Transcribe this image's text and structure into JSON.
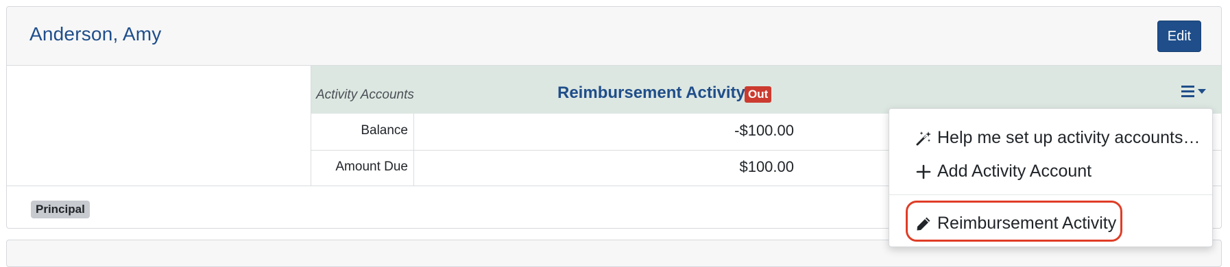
{
  "person": {
    "name": "Anderson, Amy"
  },
  "header": {
    "edit_label": "Edit"
  },
  "table": {
    "accounts_label": "Activity Accounts",
    "column_title": "Reimbursement Activity",
    "column_badge": "Out",
    "rows": [
      {
        "label": "Balance",
        "value": "-$100.00"
      },
      {
        "label": "Amount Due",
        "value": "$100.00"
      }
    ]
  },
  "tags": {
    "principal": "Principal"
  },
  "dropdown": {
    "items": [
      {
        "label": "Help me set up activity accounts…",
        "icon": "magic-wand-icon"
      },
      {
        "label": "Add Activity Account",
        "icon": "plus-icon"
      },
      {
        "label": "Reimbursement Activity",
        "icon": "pencil-icon"
      }
    ]
  },
  "colors": {
    "brand_blue": "#1f4e8a",
    "header_row_bg": "#dde7e1",
    "out_badge": "#cc3b2f",
    "highlight_ring": "#df3d26",
    "tag_bg": "#c7cbd0"
  }
}
